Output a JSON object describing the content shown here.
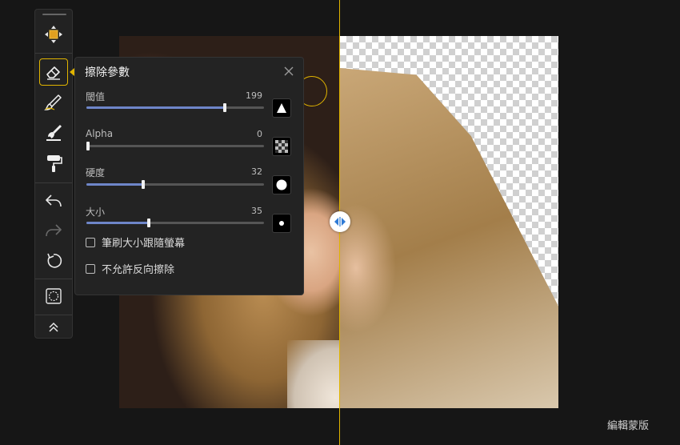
{
  "panel": {
    "title": "擦除參數",
    "close_icon": "close-icon",
    "sliders": [
      {
        "label": "閾值",
        "value": "199",
        "fraction": 0.78,
        "shape_icon": "triangle-icon"
      },
      {
        "label": "Alpha",
        "value": "0",
        "fraction": 0.0,
        "shape_icon": "checker-icon"
      },
      {
        "label": "硬度",
        "value": "32",
        "fraction": 0.32,
        "shape_icon": "circle-large-icon"
      },
      {
        "label": "大小",
        "value": "35",
        "fraction": 0.35,
        "shape_icon": "circle-small-icon"
      }
    ],
    "checkboxes": [
      {
        "label": "筆刷大小跟隨螢幕",
        "checked": false
      },
      {
        "label": "不允許反向擦除",
        "checked": false
      }
    ]
  },
  "toolbar": {
    "tools": [
      "move-icon",
      "eraser-icon",
      "brush-icon",
      "paint-brush-icon",
      "roller-icon",
      "undo-icon",
      "redo-icon",
      "reset-icon",
      "mask-icon",
      "collapse-icon"
    ]
  },
  "bottom": {
    "label": "編輯蒙版"
  },
  "colors": {
    "accent": "#e0b400",
    "slider_fill": "#6e86c9",
    "background": "#161616"
  }
}
